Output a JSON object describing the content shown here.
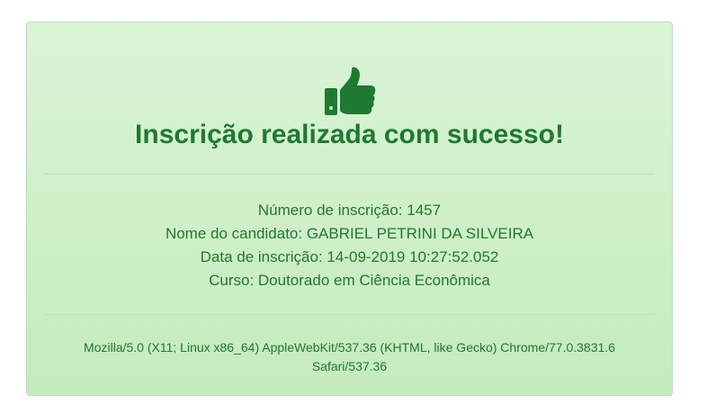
{
  "alert": {
    "icon": "thumbs-up-icon",
    "heading": "Inscrição realizada com sucesso!",
    "registration_number": "Número de inscrição: 1457",
    "candidate_name": "Nome do candidato: GABRIEL PETRINI DA SILVEIRA",
    "registration_date": "Data de inscrição: 14-09-2019 10:27:52.052",
    "course": "Curso: Doutorado em Ciência Econômica",
    "user_agent": "Mozilla/5.0 (X11; Linux x86_64) AppleWebKit/537.36 (KHTML, like Gecko) Chrome/77.0.3831.6 Safari/537.36"
  },
  "colors": {
    "success_text": "#1e7a30",
    "alert_bg_top": "#dbf4d6",
    "alert_bg_bottom": "#c4ebbe",
    "alert_border": "#b7deb9"
  }
}
